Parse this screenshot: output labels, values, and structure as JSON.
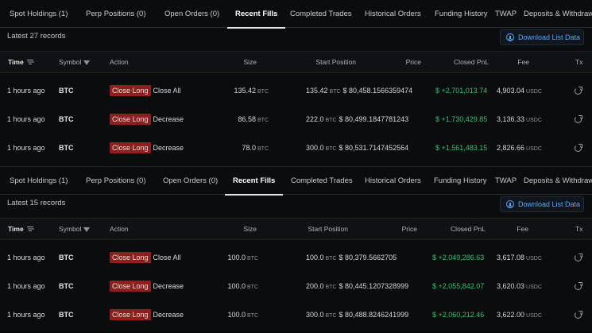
{
  "panels": [
    {
      "tabs": [
        {
          "label": "Spot Holdings (1)",
          "active": false
        },
        {
          "label": "Perp Positions (0)",
          "active": false
        },
        {
          "label": "Open Orders (0)",
          "active": false
        },
        {
          "label": "Recent Fills",
          "active": true
        },
        {
          "label": "Completed Trades",
          "active": false
        },
        {
          "label": "Historical Orders",
          "active": false
        },
        {
          "label": "Funding History",
          "active": false
        },
        {
          "label": "TWAP",
          "active": false
        },
        {
          "label": "Deposits & Withdraw",
          "active": false
        }
      ],
      "records_label": "Latest 27 records",
      "download_label": "Download List Data",
      "columns": {
        "time": "Time",
        "symbol": "Symbol",
        "action": "Action",
        "size": "Size",
        "start_position": "Start Position",
        "price": "Price",
        "closed_pnl": "Closed PnL",
        "fee": "Fee",
        "tx": "Tx"
      },
      "rows": [
        {
          "time": "1 hours ago",
          "symbol": "BTC",
          "badge": "Close Long",
          "action": "Close All",
          "size": "135.42",
          "size_unit": "BTC",
          "start_pos": "135.42",
          "start_unit": "BTC",
          "price": "$ 80,458.1566359474",
          "pnl": "$ +2,701,013.74",
          "fee": "4,903.04",
          "fee_unit": "USDC"
        },
        {
          "time": "1 hours ago",
          "symbol": "BTC",
          "badge": "Close Long",
          "action": "Decrease",
          "size": "86.58",
          "size_unit": "BTC",
          "start_pos": "222.0",
          "start_unit": "BTC",
          "price": "$ 80,499.1847781243",
          "pnl": "$ +1,730,429.85",
          "fee": "3,136.33",
          "fee_unit": "USDC"
        },
        {
          "time": "1 hours ago",
          "symbol": "BTC",
          "badge": "Close Long",
          "action": "Decrease",
          "size": "78.0",
          "size_unit": "BTC",
          "start_pos": "300.0",
          "start_unit": "BTC",
          "price": "$ 80,531.7147452564",
          "pnl": "$ +1,561,483.15",
          "fee": "2,826.66",
          "fee_unit": "USDC"
        }
      ]
    },
    {
      "tabs": [
        {
          "label": "Spot Holdings (1)",
          "active": false
        },
        {
          "label": "Perp Positions (0)",
          "active": false
        },
        {
          "label": "Open Orders (0)",
          "active": false
        },
        {
          "label": "Recent Fills",
          "active": true
        },
        {
          "label": "Completed Trades",
          "active": false
        },
        {
          "label": "Historical Orders",
          "active": false
        },
        {
          "label": "Funding History",
          "active": false
        },
        {
          "label": "TWAP",
          "active": false
        },
        {
          "label": "Deposits & Withdraw",
          "active": false
        }
      ],
      "records_label": "Latest 15 records",
      "download_label": "Download List Data",
      "columns": {
        "time": "Time",
        "symbol": "Symbol",
        "action": "Action",
        "size": "Size",
        "start_position": "Start Position",
        "price": "Price",
        "closed_pnl": "Closed PnL",
        "fee": "Fee",
        "tx": "Tx"
      },
      "rows": [
        {
          "time": "1 hours ago",
          "symbol": "BTC",
          "badge": "Close Long",
          "action": "Close All",
          "size": "100.0",
          "size_unit": "BTC",
          "start_pos": "100.0",
          "start_unit": "BTC",
          "price": "$ 80,379.5662705",
          "pnl": "$ +2,049,286.63",
          "fee": "3,617.08",
          "fee_unit": "USDC"
        },
        {
          "time": "1 hours ago",
          "symbol": "BTC",
          "badge": "Close Long",
          "action": "Decrease",
          "size": "100.0",
          "size_unit": "BTC",
          "start_pos": "200.0",
          "start_unit": "BTC",
          "price": "$ 80,445.1207328999",
          "pnl": "$ +2,055,842.07",
          "fee": "3,620.03",
          "fee_unit": "USDC"
        },
        {
          "time": "1 hours ago",
          "symbol": "BTC",
          "badge": "Close Long",
          "action": "Decrease",
          "size": "100.0",
          "size_unit": "BTC",
          "start_pos": "300.0",
          "start_unit": "BTC",
          "price": "$ 80,488.8246241999",
          "pnl": "$ +2,060,212.46",
          "fee": "3,622.00",
          "fee_unit": "USDC"
        }
      ]
    }
  ]
}
